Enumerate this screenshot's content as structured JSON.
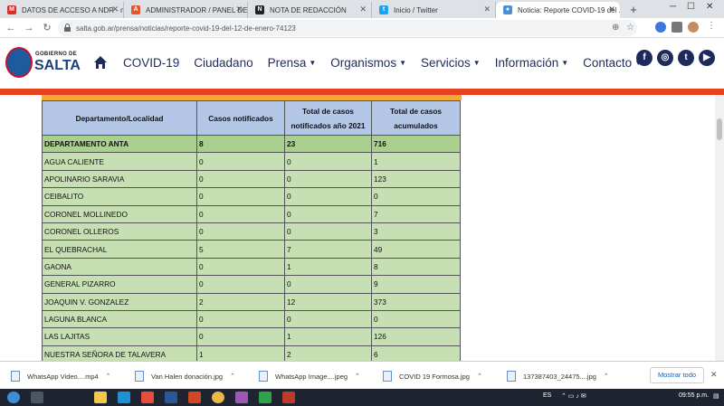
{
  "browser": {
    "tabs": [
      {
        "title": "DATOS DE ACCESO A NDR - n...",
        "favicon": "gmail-icon",
        "color": "#d93025",
        "glyph": "M"
      },
      {
        "title": "ADMINISTRADOR / PANEL DE ...",
        "favicon": "admin-icon",
        "color": "#e8552b",
        "glyph": "A"
      },
      {
        "title": "NOTA DE REDACCIÓN",
        "favicon": "ndr-icon",
        "color": "#222222",
        "glyph": "N"
      },
      {
        "title": "Inicio / Twitter",
        "favicon": "twitter-icon",
        "color": "#1da1f2",
        "glyph": "t"
      },
      {
        "title": "Noticia: Reporte COVID-19 del ...",
        "favicon": "globe-icon",
        "color": "#4a8fd6",
        "glyph": "●"
      }
    ],
    "new_tab": "+",
    "url": "salta.gob.ar/prensa/noticias/reporte-covid-19-del-12-de-enero-74123"
  },
  "site": {
    "logo_top": "GOBIERNO DE",
    "logo_name": "SALTA",
    "menu": [
      {
        "label": "COVID-19",
        "dropdown": false
      },
      {
        "label": "Ciudadano",
        "dropdown": false
      },
      {
        "label": "Prensa",
        "dropdown": true
      },
      {
        "label": "Organismos",
        "dropdown": true
      },
      {
        "label": "Servicios",
        "dropdown": true
      },
      {
        "label": "Información",
        "dropdown": true
      },
      {
        "label": "Contacto",
        "dropdown": true
      }
    ],
    "social": [
      {
        "name": "facebook-icon",
        "glyph": "f"
      },
      {
        "name": "instagram-icon",
        "glyph": "◎"
      },
      {
        "name": "twitter-icon",
        "glyph": "t"
      },
      {
        "name": "youtube-icon",
        "glyph": "▶"
      }
    ],
    "accent": "#e8411e",
    "brand": "#1d2b5c"
  },
  "table": {
    "headers": [
      {
        "l1": "Departamento/Localidad",
        "l2": ""
      },
      {
        "l1": "Casos notificados",
        "l2": ""
      },
      {
        "l1": "Total de casos",
        "l2": "notificados año 2021"
      },
      {
        "l1": "Total de casos",
        "l2": "acumulados"
      }
    ],
    "total_row": [
      "DEPARTAMENTO ANTA",
      "8",
      "23",
      "716"
    ],
    "rows": [
      [
        "AGUA CALIENTE",
        "0",
        "0",
        "1"
      ],
      [
        "APOLINARIO SARAVIA",
        "0",
        "0",
        "123"
      ],
      [
        "CEIBALITO",
        "0",
        "0",
        "0"
      ],
      [
        "CORONEL MOLLINEDO",
        "0",
        "0",
        "7"
      ],
      [
        "CORONEL OLLEROS",
        "0",
        "0",
        "3"
      ],
      [
        "EL QUEBRACHAL",
        "5",
        "7",
        "49"
      ],
      [
        "GAONA",
        "0",
        "1",
        "8"
      ],
      [
        "GENERAL PIZARRO",
        "0",
        "0",
        "9"
      ],
      [
        "JOAQUIN V. GONZALEZ",
        "2",
        "12",
        "373"
      ],
      [
        "LAGUNA BLANCA",
        "0",
        "0",
        "0"
      ],
      [
        "LAS LAJITAS",
        "0",
        "1",
        "126"
      ],
      [
        "NUESTRA SEÑORA DE TALAVERA",
        "1",
        "2",
        "6"
      ]
    ]
  },
  "downloads": {
    "items": [
      "WhatsApp Video....mp4",
      "Van Halen donación.jpg",
      "WhatsApp Image....jpeg",
      "COVID 19 Formosa.jpg",
      "137387403_24475....jpg"
    ],
    "show_all": "Mostrar todo"
  },
  "taskbar": {
    "lang": "ES",
    "time": "09:55 p.m."
  }
}
